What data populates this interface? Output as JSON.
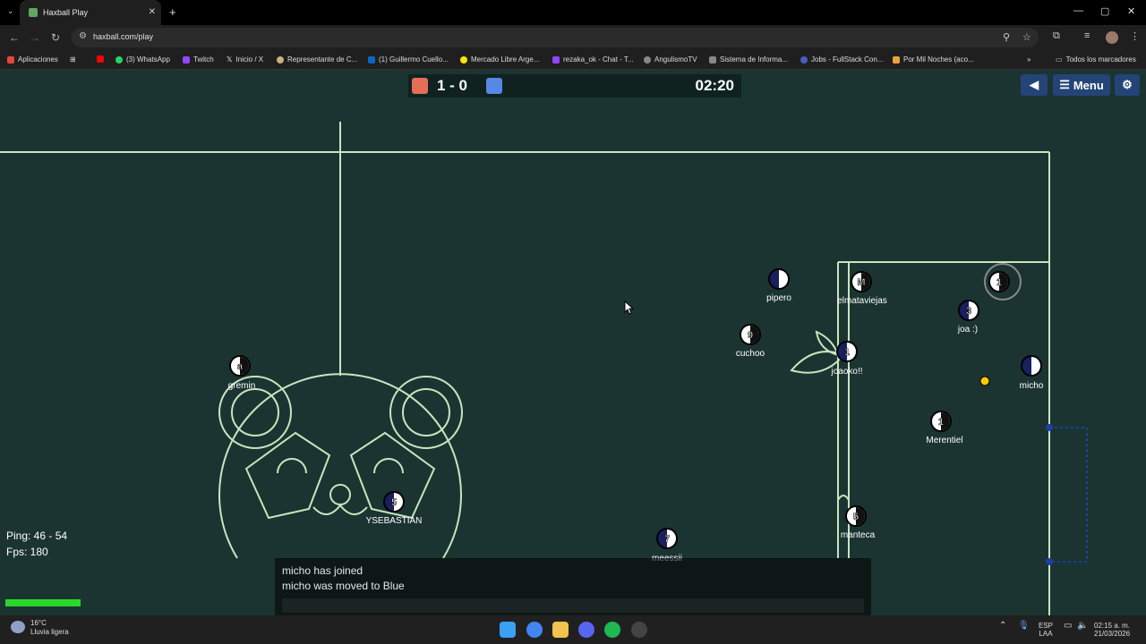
{
  "browser": {
    "tab_title": "Haxball Play",
    "url": "haxball.com/play",
    "bookmarks": [
      {
        "label": "Aplicaciones",
        "color": "#ddd"
      },
      {
        "label": "(3) WhatsApp",
        "color": "#25d366"
      },
      {
        "label": "Twitch",
        "color": "#9146ff"
      },
      {
        "label": "Inicio / X",
        "color": "#ffffff"
      },
      {
        "label": "Representante de C...",
        "color": "#c9b37a"
      },
      {
        "label": "(1) Guillermo Cuello...",
        "color": "#0a66c2"
      },
      {
        "label": "Mercado Libre Arge...",
        "color": "#ffe600"
      },
      {
        "label": "rezaka_ok - Chat - T...",
        "color": "#9146ff"
      },
      {
        "label": "AngulismoTV",
        "color": "#cccccc"
      },
      {
        "label": "Sistema de Informa...",
        "color": "#cccccc"
      },
      {
        "label": "Jobs - FullStack Con...",
        "color": "#4b5cc4"
      },
      {
        "label": "Por Mil Noches (aco...",
        "color": "#e8a33d"
      }
    ],
    "all_bookmarks": "Todos los marcadores"
  },
  "game": {
    "score": "1 - 0",
    "clock": "02:20",
    "menu_label": "Menu",
    "ping": "Ping: 46 - 54",
    "fps": "Fps: 180",
    "team_colors": {
      "red": "#e56e56",
      "blue": "#5689e5",
      "lines": "#c7e6bd",
      "field": "#1b3432"
    },
    "players": [
      {
        "name": "pipero",
        "number": "",
        "team": "blue"
      },
      {
        "name": "elmataviejas",
        "number": "M",
        "team": "red"
      },
      {
        "name": "",
        "number": "1",
        "team": "red"
      },
      {
        "name": "joa :)",
        "number": "3",
        "team": "blue"
      },
      {
        "name": "cuchoo",
        "number": "9",
        "team": "red"
      },
      {
        "name": "joaoko!!",
        "number": "1",
        "team": "blue"
      },
      {
        "name": "micho",
        "number": "",
        "team": "blue"
      },
      {
        "name": "gremin",
        "number": "a",
        "team": "red"
      },
      {
        "name": "Merentiel",
        "number": "1",
        "team": "red"
      },
      {
        "name": "YSEBASTIAN",
        "number": "5",
        "team": "blue"
      },
      {
        "name": "manteca",
        "number": "5",
        "team": "red"
      },
      {
        "name": "meessii",
        "number": "7",
        "team": "blue"
      }
    ],
    "chat": [
      "micho has joined",
      "micho was moved to Blue"
    ]
  },
  "taskbar": {
    "temp": "16°C",
    "weather": "Lluvia ligera",
    "lang1": "ESP",
    "lang2": "LAA",
    "time": "02:15 a. m.",
    "date": "21/03/2026"
  }
}
